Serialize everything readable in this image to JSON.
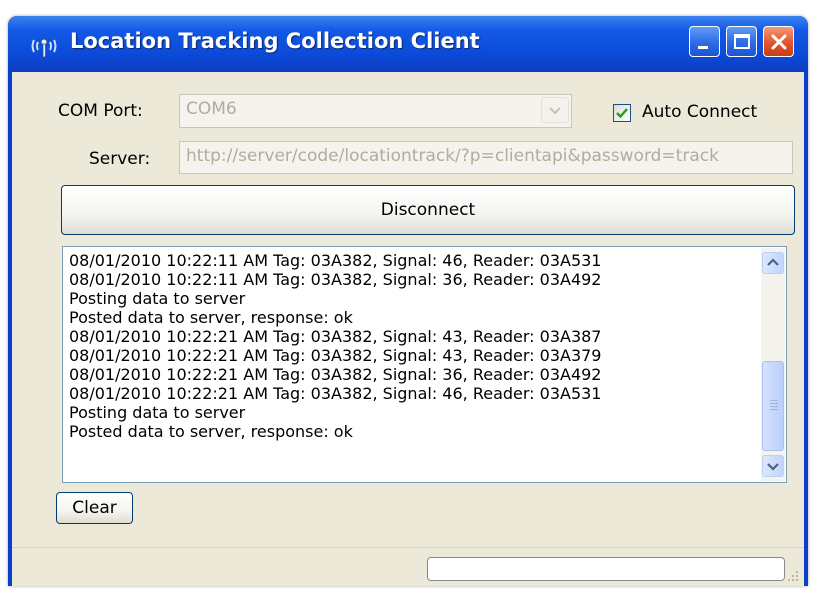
{
  "window": {
    "title": "Location Tracking Collection Client",
    "controls": [
      "minimize",
      "maximize",
      "close"
    ]
  },
  "form": {
    "com_port_label": "COM Port:",
    "com_port_value": "COM6",
    "auto_connect_label": "Auto Connect",
    "auto_connect_checked": true,
    "server_label": "Server:",
    "server_value": "http://server/code/locationtrack/?p=clientapi&password=track",
    "disconnect_label": "Disconnect",
    "clear_label": "Clear"
  },
  "log": {
    "lines": [
      "08/01/2010 10:22:11 AM Tag: 03A382, Signal: 46, Reader: 03A531",
      "08/01/2010 10:22:11 AM Tag: 03A382, Signal: 36, Reader: 03A492",
      "Posting data to server",
      "Posted data to server, response: ok",
      "08/01/2010 10:22:21 AM Tag: 03A382, Signal: 43, Reader: 03A387",
      "08/01/2010 10:22:21 AM Tag: 03A382, Signal: 43, Reader: 03A379",
      "08/01/2010 10:22:21 AM Tag: 03A382, Signal: 36, Reader: 03A492",
      "08/01/2010 10:22:21 AM Tag: 03A382, Signal: 46, Reader: 03A531",
      "Posting data to server",
      "Posted data to server, response: ok"
    ]
  },
  "icons": {
    "app": "antenna-icon",
    "check": "checkmark-icon",
    "combo_arrow": "chevron-down-icon",
    "scroll_up": "chevron-up-icon",
    "scroll_down": "chevron-down-icon",
    "size_grip": "resize-grip-icon"
  },
  "colors": {
    "title_bar": "#0b4ad8",
    "close_button": "#e0552d",
    "client_bg": "#ece9d8",
    "disabled_text": "#b0ad9e",
    "check_mark": "#21a121"
  }
}
